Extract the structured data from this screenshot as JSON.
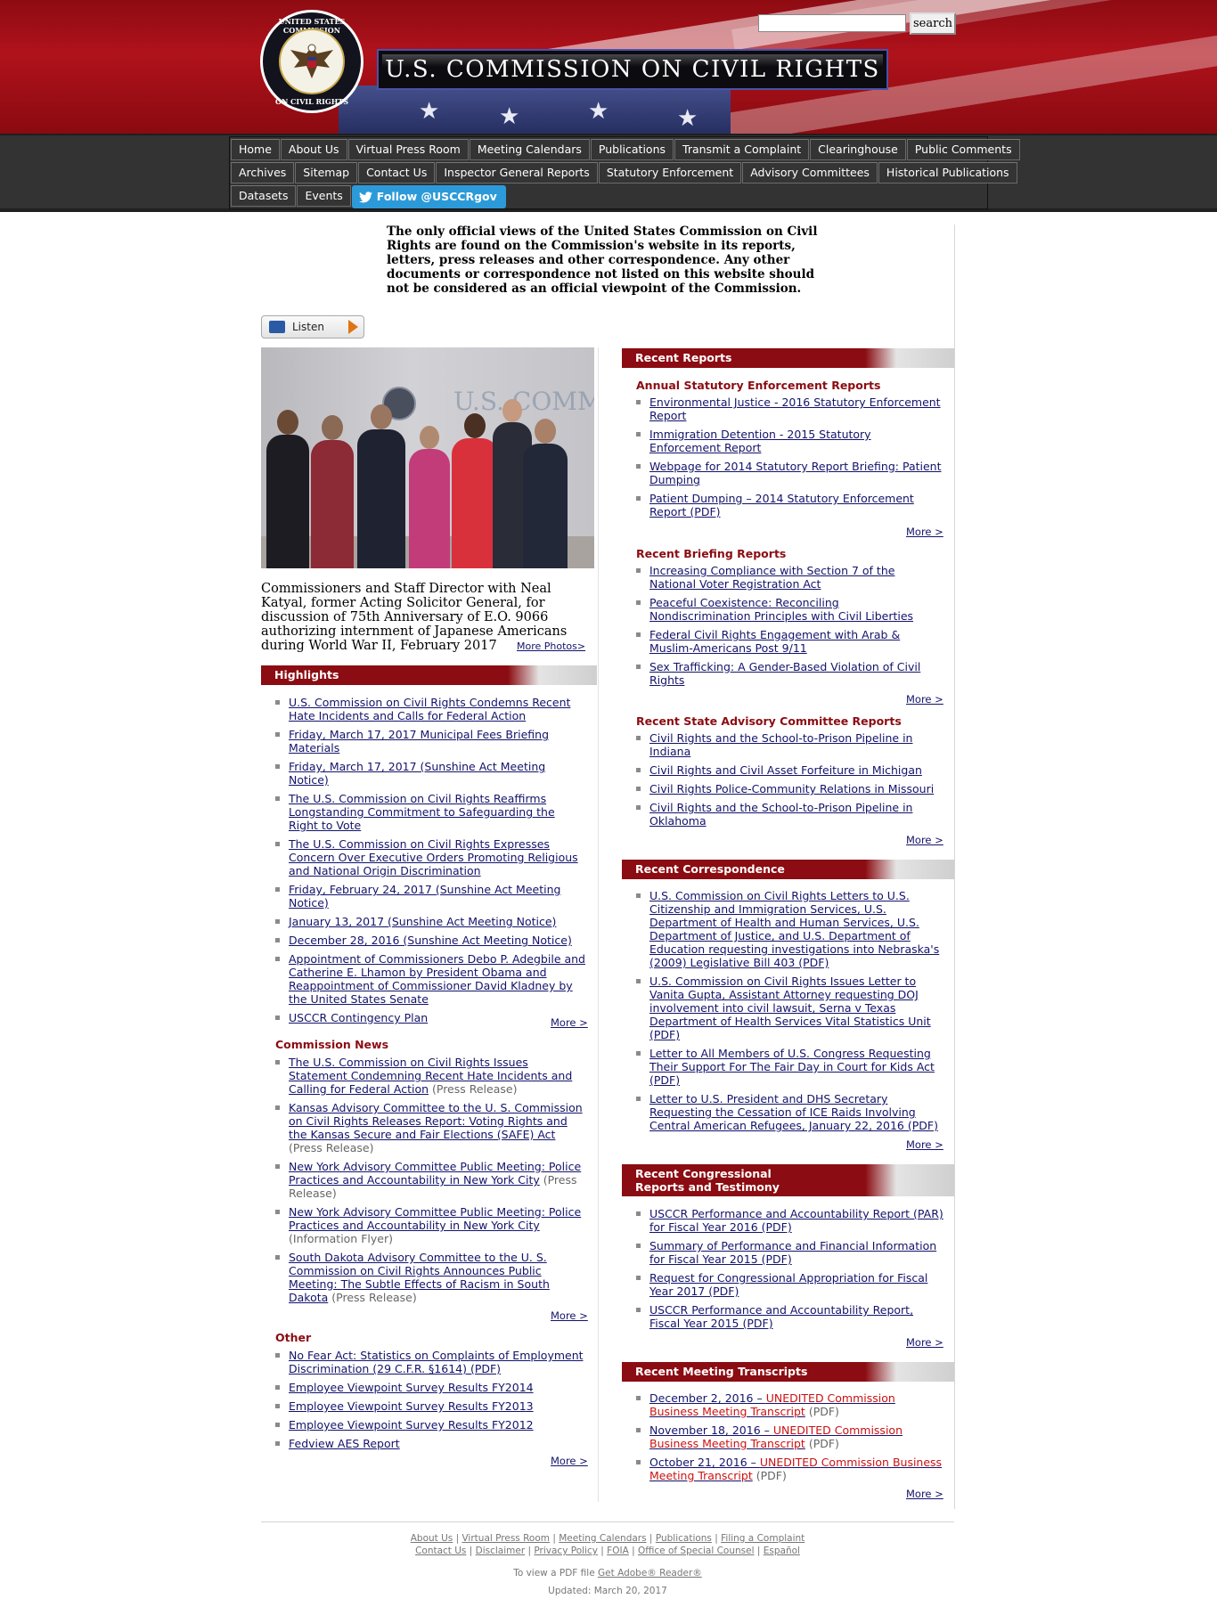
{
  "header": {
    "title": "U.S. COMMISSION ON CIVIL RIGHTS",
    "seal_top_text": "UNITED STATES COMMISSION",
    "seal_bottom_text": "ON CIVIL RIGHTS",
    "search_button": "search",
    "search_value": ""
  },
  "nav": {
    "row1": [
      "Home",
      "About Us",
      "Virtual Press Room",
      "Meeting Calendars",
      "Publications",
      "Transmit a Complaint",
      "Clearinghouse",
      "Public Comments"
    ],
    "row2": [
      "Archives",
      "Sitemap",
      "Contact Us",
      "Inspector General Reports",
      "Statutory Enforcement",
      "Advisory Committees",
      "Historical Publications"
    ],
    "row3": [
      "Datasets",
      "Events"
    ],
    "twitter": "Follow @USCCRgov"
  },
  "disclaimer": "The only official views of the United States Commission on Civil Rights are found on the Commission's website in its reports, letters, press releases and other correspondence. Any other documents or correspondence not listed on this website should not be considered as an official viewpoint of the Commission.",
  "listen": "Listen",
  "photo": {
    "wall_text": "U.S. COMMISSION ON CIVIL RIGHTS",
    "caption": "Commissioners and Staff Director with Neal Katyal, former Acting Solicitor General, for discussion of 75th Anniversary of E.O. 9066 authorizing internment of Japanese Americans during World War II, February 2017",
    "more_photos": "More Photos>"
  },
  "highlights": {
    "title": "Highlights",
    "items": [
      "U.S. Commission on Civil Rights Condemns Recent Hate Incidents and Calls for Federal Action",
      "Friday, March 17, 2017 Municipal Fees Briefing Materials",
      "Friday, March 17, 2017 (Sunshine Act Meeting Notice)",
      "The U.S. Commission on Civil Rights Reaffirms Longstanding Commitment to Safeguarding the Right to Vote",
      "The U.S. Commission on Civil Rights Expresses Concern Over Executive Orders Promoting Religious and National Origin Discrimination",
      "Friday, February 24, 2017 (Sunshine Act Meeting Notice)",
      "January 13, 2017 (Sunshine Act Meeting Notice)",
      "December 28, 2016 (Sunshine Act Meeting Notice)",
      "Appointment of Commissioners Debo P. Adegbile and Catherine E. Lhamon by President Obama and Reappointment of Commissioner David Kladney by the United States Senate",
      "USCCR Contingency Plan"
    ],
    "more": "More >"
  },
  "commission_news": {
    "title": "Commission News",
    "items": [
      {
        "link": "The U.S. Commission on Civil Rights Issues Statement Condemning Recent Hate Incidents and Calling for Federal Action",
        "note": "(Press Release)"
      },
      {
        "link": "Kansas Advisory Committee to the U. S. Commission on Civil Rights Releases Report: Voting Rights and the Kansas Secure and Fair Elections (SAFE) Act",
        "note": "(Press Release)"
      },
      {
        "link": "New York Advisory Committee Public Meeting: Police Practices and Accountability in New York City",
        "note": "(Press Release)"
      },
      {
        "link": "New York Advisory Committee Public Meeting: Police Practices and Accountability in New York City",
        "note": "(Information Flyer)"
      },
      {
        "link": "South Dakota Advisory Committee to the U. S. Commission on Civil Rights Announces Public Meeting: The Subtle Effects of Racism in South Dakota",
        "note": "(Press Release)"
      }
    ],
    "more": "More >"
  },
  "other": {
    "title": "Other",
    "items": [
      "No Fear Act: Statistics on Complaints of Employment Discrimination (29 C.F.R. §1614) (PDF)",
      "Employee Viewpoint Survey Results FY2014",
      "Employee Viewpoint Survey Results FY2013",
      "Employee Viewpoint Survey Results FY2012",
      "Fedview AES Report"
    ],
    "more": "More >"
  },
  "recent_reports": {
    "title": "Recent Reports",
    "annual": {
      "title": "Annual Statutory Enforcement Reports",
      "items": [
        "Environmental Justice - 2016 Statutory Enforcement Report",
        "Immigration Detention - 2015 Statutory Enforcement Report",
        "Webpage for 2014 Statutory Report Briefing: Patient Dumping",
        "Patient Dumping – 2014 Statutory Enforcement Report (PDF)"
      ],
      "more": "More >"
    },
    "briefing": {
      "title": "Recent Briefing Reports",
      "items": [
        "Increasing Compliance with Section 7 of the National Voter Registration Act",
        "Peaceful Coexistence: Reconciling Nondiscrimination Principles with Civil Liberties",
        "Federal Civil Rights Engagement with Arab & Muslim-Americans Post 9/11",
        "Sex Trafficking: A Gender-Based Violation of Civil Rights"
      ],
      "more": "More >"
    },
    "state": {
      "title": "Recent State Advisory Committee Reports",
      "items": [
        "Civil Rights and the School-to-Prison Pipeline in Indiana",
        "Civil Rights and Civil Asset Forfeiture in Michigan",
        "Civil Rights Police-Community Relations in Missouri",
        "Civil Rights and the School-to-Prison Pipeline in Oklahoma"
      ],
      "more": "More >"
    }
  },
  "correspondence": {
    "title": "Recent Correspondence",
    "items": [
      "U.S. Commission on Civil Rights Letters to U.S. Citizenship and Immigration Services, U.S. Department of Health and Human Services, U.S. Department of Justice, and U.S. Department of Education requesting investigations into Nebraska's (2009) Legislative Bill 403 (PDF)",
      "U.S. Commission on Civil Rights Issues Letter to Vanita Gupta, Assistant Attorney requesting DOJ involvement into civil lawsuit, Serna v Texas Department of Health Services Vital Statistics Unit (PDF)",
      "Letter to All Members of U.S. Congress Requesting Their Support For The Fair Day in Court for Kids Act (PDF)",
      "Letter to U.S. President and DHS Secretary Requesting the Cessation of ICE Raids Involving Central American Refugees, January 22, 2016 (PDF)"
    ],
    "more": "More >"
  },
  "congressional": {
    "title_line1": "Recent Congressional",
    "title_line2": "Reports and Testimony",
    "items": [
      "USCCR Performance and Accountability Report (PAR) for Fiscal Year 2016 (PDF)",
      "Summary of Performance and Financial Information for Fiscal Year 2015 (PDF)",
      "Request for Congressional Appropriation for Fiscal Year 2017 (PDF)",
      "USCCR Performance and Accountability Report, Fiscal Year 2015 (PDF)"
    ],
    "more": "More >"
  },
  "transcripts": {
    "title": "Recent Meeting Transcripts",
    "items": [
      {
        "date": "December 2, 2016 – ",
        "red": "UNEDITED Commission Business Meeting Transcript",
        "note": "(PDF)"
      },
      {
        "date": "November 18, 2016 – ",
        "red": "UNEDITED Commission Business Meeting Transcript",
        "note": "(PDF)"
      },
      {
        "date": "October 21, 2016 – ",
        "red": "UNEDITED Commission Business Meeting Transcript",
        "note": "(PDF)"
      }
    ],
    "more": "More >"
  },
  "footer": {
    "row1": [
      "About Us",
      "Virtual Press Room",
      "Meeting Calendars",
      "Publications",
      "Filing a Complaint"
    ],
    "row2": [
      "Contact Us",
      "Disclaimer",
      "Privacy Policy",
      "FOIA",
      "Office of Special Counsel",
      "Español"
    ],
    "pdf_prefix": "To view a PDF file",
    "pdf_link": "Get Adobe® Reader®",
    "updated": "Updated: March 20, 2017"
  },
  "colors": {
    "header_red": "#a5111a",
    "section_red": "#8b0c12",
    "link": "#13136b",
    "nav_bg": "#333333",
    "twitter": "#2c9ad8"
  }
}
